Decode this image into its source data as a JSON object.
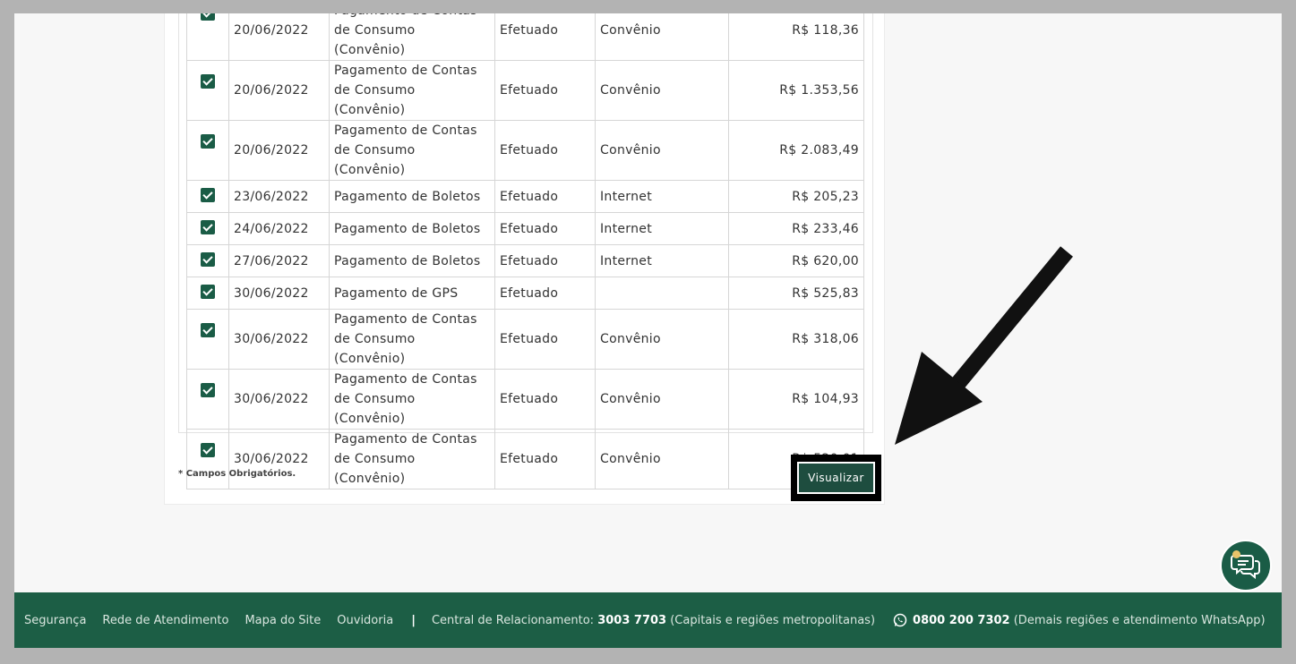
{
  "table": {
    "rows": [
      {
        "date": "20/06/2022",
        "description": "Pagamento de Contas de Consumo (Convênio)",
        "status": "Efetuado",
        "channel": "Convênio",
        "amount": "R$ 118,36",
        "checked": true
      },
      {
        "date": "20/06/2022",
        "description": "Pagamento de Contas de Consumo (Convênio)",
        "status": "Efetuado",
        "channel": "Convênio",
        "amount": "R$ 1.353,56",
        "checked": true
      },
      {
        "date": "20/06/2022",
        "description": "Pagamento de Contas de Consumo (Convênio)",
        "status": "Efetuado",
        "channel": "Convênio",
        "amount": "R$ 2.083,49",
        "checked": true
      },
      {
        "date": "23/06/2022",
        "description": "Pagamento de Boletos",
        "status": "Efetuado",
        "channel": "Internet",
        "amount": "R$ 205,23",
        "checked": true
      },
      {
        "date": "24/06/2022",
        "description": "Pagamento de Boletos",
        "status": "Efetuado",
        "channel": "Internet",
        "amount": "R$ 233,46",
        "checked": true
      },
      {
        "date": "27/06/2022",
        "description": "Pagamento de Boletos",
        "status": "Efetuado",
        "channel": "Internet",
        "amount": "R$ 620,00",
        "checked": true
      },
      {
        "date": "30/06/2022",
        "description": "Pagamento de GPS",
        "status": "Efetuado",
        "channel": "",
        "amount": "R$ 525,83",
        "checked": true
      },
      {
        "date": "30/06/2022",
        "description": "Pagamento de Contas de Consumo (Convênio)",
        "status": "Efetuado",
        "channel": "Convênio",
        "amount": "R$ 318,06",
        "checked": true
      },
      {
        "date": "30/06/2022",
        "description": "Pagamento de Contas de Consumo (Convênio)",
        "status": "Efetuado",
        "channel": "Convênio",
        "amount": "R$ 104,93",
        "checked": true
      },
      {
        "date": "30/06/2022",
        "description": "Pagamento de Contas de Consumo (Convênio)",
        "status": "Efetuado",
        "channel": "Convênio",
        "amount": "R$ 520,01",
        "checked": true
      }
    ]
  },
  "form": {
    "required_note": "* Campos Obrigatórios.",
    "view_button_label": "Visualizar"
  },
  "footer": {
    "links": [
      "Segurança",
      "Rede de Atendimento",
      "Mapa do Site",
      "Ouvidoria"
    ],
    "separator": "|",
    "central_label": "Central de Relacionamento:",
    "central_phone": "3003 7703",
    "central_note": "(Capitais e regiões metropolitanas)",
    "whatsapp_phone": "0800 200 7302",
    "whatsapp_note": "(Demais regiões e atendimento WhatsApp)"
  },
  "icons": {
    "chat": "chat-bubbles-icon",
    "whatsapp": "whatsapp-icon",
    "checkbox": "checkbox-checked-icon",
    "annotation_arrow": "arrow-annotation-icon"
  },
  "colors": {
    "brand_green": "#1c5e45",
    "button_green": "#1e4d3f",
    "checkbox_green": "#1a5c46"
  }
}
